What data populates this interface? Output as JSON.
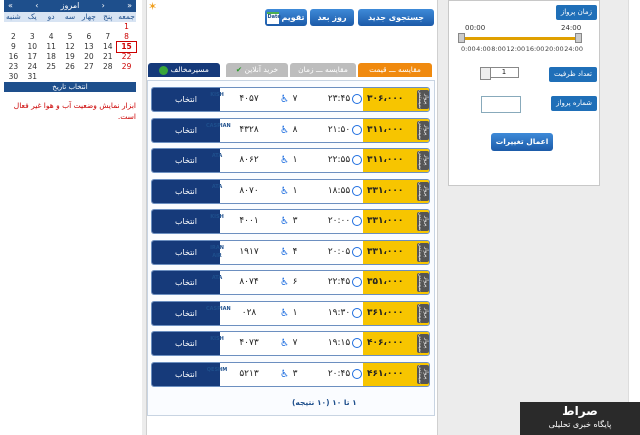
{
  "calendar": {
    "prev": "«",
    "prev2": "‹",
    "today": "امروز",
    "next": "›",
    "next2": "»",
    "weekdays": [
      "شنبه",
      "یک",
      "دو",
      "سه",
      "چهار",
      "پنج",
      "جمعه"
    ],
    "days": [
      [
        "",
        "",
        "",
        "",
        "",
        "",
        "1"
      ],
      [
        "2",
        "3",
        "4",
        "5",
        "6",
        "7",
        "8"
      ],
      [
        "9",
        "10",
        "11",
        "12",
        "13",
        "14",
        "15"
      ],
      [
        "16",
        "17",
        "18",
        "19",
        "20",
        "21",
        "22"
      ],
      [
        "23",
        "24",
        "25",
        "26",
        "27",
        "28",
        "29"
      ],
      [
        "30",
        "31",
        "",
        "",
        "",
        "",
        "",
        ""
      ]
    ],
    "select_label": "انتخاب تاریخ"
  },
  "note": "ابزار نمایش وضعیت آب و هوا غیر فعال است.",
  "toolbar": {
    "new_search": "جستجوی جدید",
    "next_day": "روز بعد",
    "calendar": "تقویم",
    "date_icon": "Date"
  },
  "tabs": {
    "price": "مقایسه ـــ قیمت",
    "time": "مقایسه ـــ زمان",
    "online": "خرید آنلاین",
    "reverse": "مسیرمخالف"
  },
  "rows": [
    {
      "select": "انتخاب",
      "airline": "KISH",
      "flight": "۴۰۵۷",
      "cap": "۷",
      "time": "۲۳:۴۵",
      "price": "۳۰۶،۰۰۰"
    },
    {
      "select": "انتخاب",
      "airline": "CASPIAN",
      "flight": "۴۳۲۸",
      "cap": "۸",
      "time": "۲۱:۵۰",
      "price": "۳۱۱،۰۰۰"
    },
    {
      "select": "انتخاب",
      "airline": "ATA",
      "flight": "۸۰۶۲",
      "cap": "۱",
      "time": "۲۲:۵۵",
      "price": "۳۱۱،۰۰۰"
    },
    {
      "select": "انتخاب",
      "airline": "ATA",
      "flight": "۸۰۷۰",
      "cap": "۱",
      "time": "۱۸:۵۵",
      "price": "۳۳۱،۰۰۰"
    },
    {
      "select": "انتخاب",
      "airline": "KISH",
      "flight": "۴۰۰۱",
      "cap": "۳",
      "time": "۲۰:۰۰",
      "price": "۳۳۱،۰۰۰"
    },
    {
      "select": "انتخاب",
      "airline": "IRAN AIR",
      "flight": "۱۹۱۷",
      "cap": "۴",
      "time": "۲۰:۰۵",
      "price": "۳۳۱،۰۰۰"
    },
    {
      "select": "انتخاب",
      "airline": "ATA",
      "flight": "۸۰۷۴",
      "cap": "۶",
      "time": "۲۲:۴۵",
      "price": "۳۵۱،۰۰۰"
    },
    {
      "select": "انتخاب",
      "airline": "CASPIAN",
      "flight": "۰۲۸",
      "cap": "۱",
      "time": "۱۹:۳۰",
      "price": "۳۶۱،۰۰۰"
    },
    {
      "select": "انتخاب",
      "airline": "KISH",
      "flight": "۴۰۷۳",
      "cap": "۷",
      "time": "۱۹:۱۵",
      "price": "۴۰۶،۰۰۰"
    },
    {
      "select": "انتخاب",
      "airline": "QESHM",
      "flight": "۵۲۱۳",
      "cap": "۳",
      "time": "۲۰:۴۵",
      "price": "۴۶۱،۰۰۰"
    }
  ],
  "row_tag": "پرواز سیستمی",
  "count": "۱ تا ۱۰ (۱۰ نتیجه)",
  "filters": {
    "time_label": "زمان پرواز",
    "from": "00:00",
    "to": "24:00",
    "ticks": [
      "0:00",
      "4:00",
      "8:00",
      "12:00",
      "16:00",
      "20:00",
      "24:00"
    ],
    "capacity_label": "تعداد ظرفیت",
    "capacity_value": "1",
    "flight_label": "شماره پرواز",
    "apply": "اعمال تغییرات"
  },
  "watermark": {
    "title": "صراط",
    "sub": "پایگاه خبری تحلیلی"
  }
}
